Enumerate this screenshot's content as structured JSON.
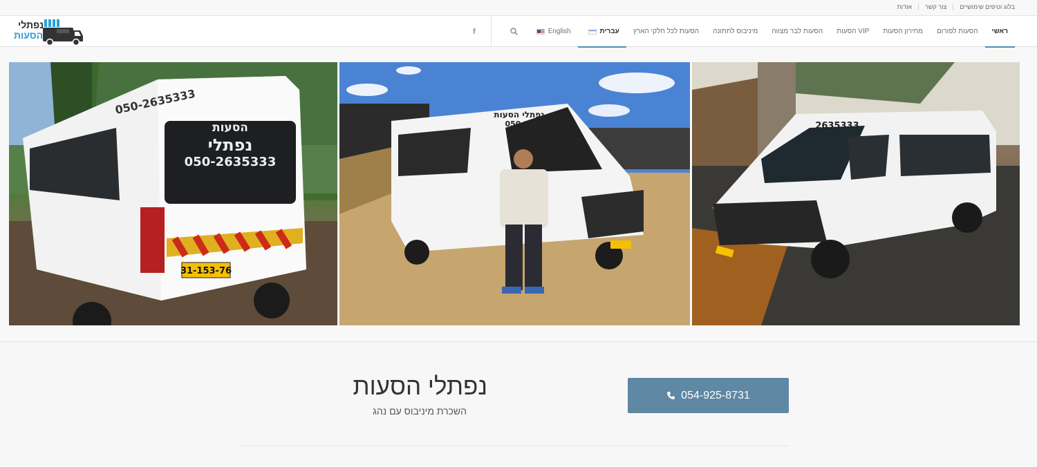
{
  "topbar": {
    "links": [
      "אודות",
      "צור קשר",
      "בלוג וטיפים שימושיים"
    ]
  },
  "logo": {
    "line1": "נפתלי",
    "line2": "הסעות",
    "accent": "#2a9fd8"
  },
  "nav": {
    "items": [
      {
        "label": "ראשי",
        "active": true
      },
      {
        "label": "הסעות לפורום"
      },
      {
        "label": "מחירון הסעות"
      },
      {
        "label": "הסעות VIP"
      },
      {
        "label": "הסעות לבר מצווה"
      },
      {
        "label": "מיניבוס לחתונה"
      },
      {
        "label": "הסעות לכל חלקי הארץ"
      }
    ],
    "lang_he": "עברית",
    "lang_en": "English",
    "search_icon": "search-icon",
    "facebook_label": "f"
  },
  "gallery": {
    "photos": [
      {
        "name": "minibus-rear-view",
        "plate": "31-153-76",
        "text_top": "הסעות",
        "text_name": "נפתלי",
        "text_phone": "050-2635333",
        "side_text": "050-2635333"
      },
      {
        "name": "driver-with-minibus",
        "plate": "",
        "text_top": "נפתלי הסעות",
        "text_phone": "050-2635333"
      },
      {
        "name": "minibus-front-view",
        "plate": "",
        "text_phone": "2635333"
      }
    ]
  },
  "hero": {
    "title": "נפתלי הסעות",
    "subtitle": "השכרת מיניבוס עם נהג",
    "phone_label": "054-925-8731",
    "button_color": "#5e88a3"
  }
}
